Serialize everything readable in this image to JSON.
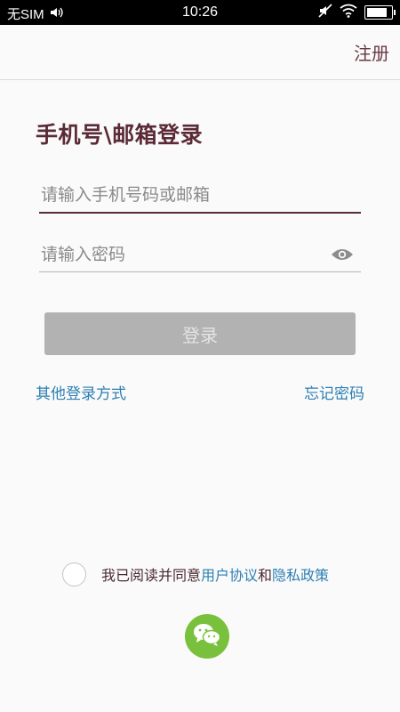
{
  "status_bar": {
    "carrier": "无SIM",
    "time": "10:26",
    "battery_level": 0.85
  },
  "header": {
    "register_label": "注册"
  },
  "login": {
    "title": "手机号\\邮箱登录",
    "phone_placeholder": "请输入手机号码或邮箱",
    "phone_value": "",
    "password_placeholder": "请输入密码",
    "password_value": "",
    "submit_label": "登录",
    "other_methods_label": "其他登录方式",
    "forgot_password_label": "忘记密码"
  },
  "agreement": {
    "checked": false,
    "prefix": "我已阅读并同意",
    "user_agreement": "用户协议",
    "connector": "和",
    "privacy_policy": "隐私政策"
  },
  "icons": {
    "signal": "audio-icon",
    "mute": "mute-icon",
    "wifi": "wifi-icon",
    "battery": "battery-icon",
    "eye": "eye-icon",
    "wechat": "wechat-icon"
  },
  "colors": {
    "accent": "#5a2a36",
    "link": "#2d7fb3",
    "button_disabled": "#b2b2b2",
    "wechat": "#79c13c"
  }
}
